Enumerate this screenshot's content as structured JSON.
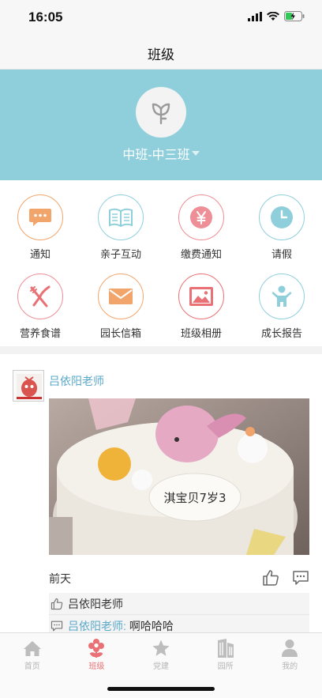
{
  "status_bar": {
    "time": "16:05"
  },
  "nav": {
    "title": "班级"
  },
  "class_info": {
    "name": "中班-中三班"
  },
  "menu": [
    {
      "label": "通知",
      "icon": "message-bubble-icon",
      "color": "#f2a56b"
    },
    {
      "label": "亲子互动",
      "icon": "open-book-icon",
      "color": "#8fcfdc"
    },
    {
      "label": "缴费通知",
      "icon": "yen-coin-icon",
      "color": "#ee8e96"
    },
    {
      "label": "请假",
      "icon": "clock-icon",
      "color": "#8fcfdc"
    },
    {
      "label": "营养食谱",
      "icon": "fork-knife-icon",
      "color": "#ee8e96"
    },
    {
      "label": "园长信箱",
      "icon": "envelope-icon",
      "color": "#f2a56b"
    },
    {
      "label": "班级相册",
      "icon": "photo-icon",
      "color": "#e97074"
    },
    {
      "label": "成长报告",
      "icon": "child-icon",
      "color": "#8fcfdc"
    }
  ],
  "post": {
    "author": "吕依阳老师",
    "photo_text": "淇宝贝7岁3",
    "time": "前天",
    "likes": "吕依阳老师",
    "comment": {
      "author": "吕依阳老师:",
      "text": "啊哈哈哈"
    }
  },
  "tabs": [
    {
      "label": "首页",
      "icon": "home-icon",
      "active": false
    },
    {
      "label": "班级",
      "icon": "flower-icon",
      "active": true
    },
    {
      "label": "党建",
      "icon": "star-icon",
      "active": false
    },
    {
      "label": "园所",
      "icon": "building-icon",
      "active": false
    },
    {
      "label": "我的",
      "icon": "person-icon",
      "active": false
    }
  ],
  "colors": {
    "accent_blue": "#8fcfdc",
    "author_blue": "#5aa9c9",
    "tab_active": "#e97074",
    "tab_inactive": "#b5b5b5"
  }
}
